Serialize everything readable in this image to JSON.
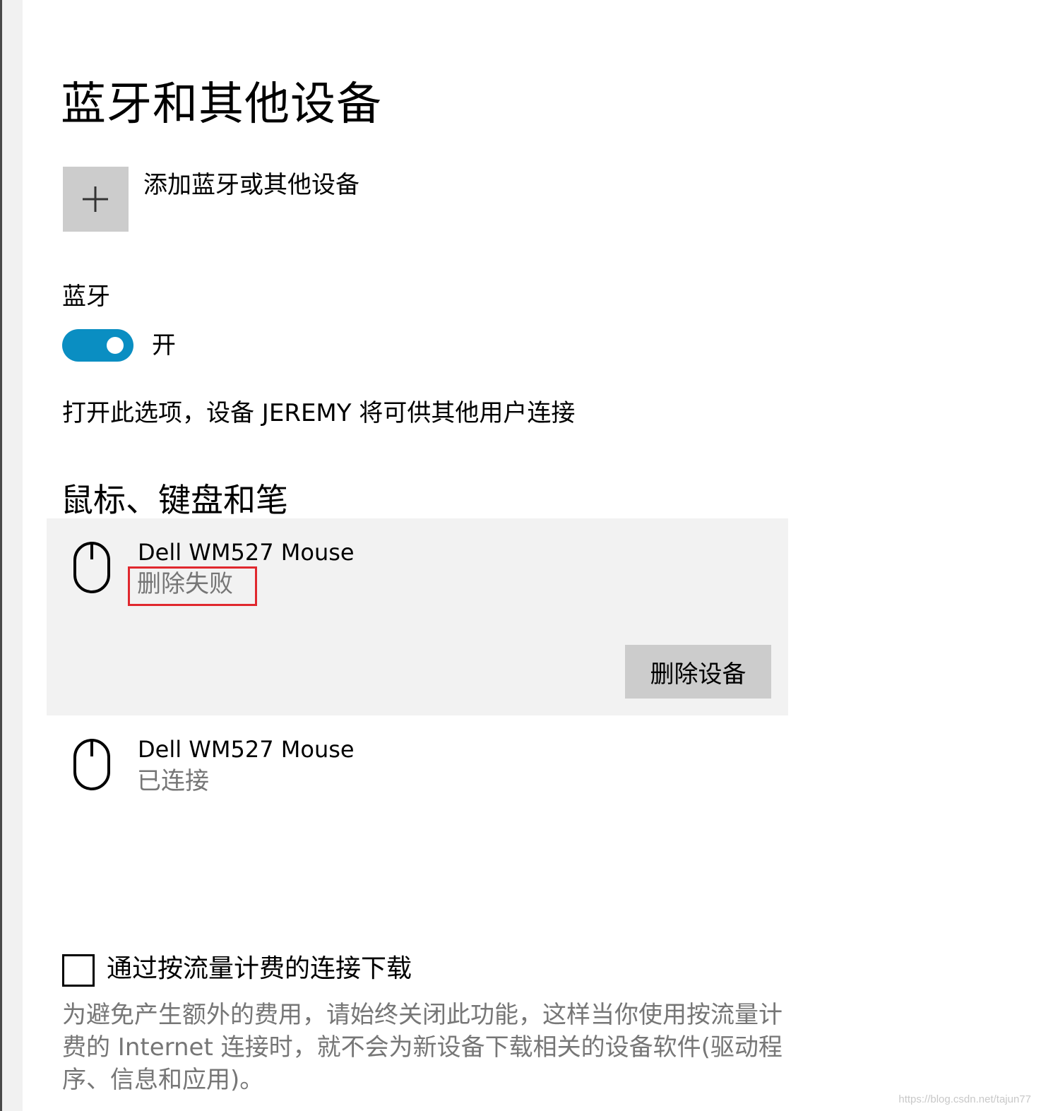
{
  "page": {
    "title": "蓝牙和其他设备"
  },
  "add_device": {
    "label": "添加蓝牙或其他设备",
    "icon": "plus-icon"
  },
  "bluetooth": {
    "label": "蓝牙",
    "toggle_state": "开",
    "toggle_on": true,
    "description": "打开此选项，设备 JEREMY 将可供其他用户连接",
    "accent_color": "#0a8ec2"
  },
  "mouse_section": {
    "title": "鼠标、键盘和笔",
    "devices": [
      {
        "name": "Dell WM527 Mouse",
        "status": "删除失败",
        "icon": "mouse-icon",
        "selected": true,
        "action_label": "删除设备"
      },
      {
        "name": "Dell WM527 Mouse",
        "status": "已连接",
        "icon": "mouse-icon",
        "selected": false
      }
    ]
  },
  "metered": {
    "checkbox_label": "通过按流量计费的连接下载",
    "checked": false,
    "description": "为避免产生额外的费用，请始终关闭此功能，这样当你使用按流量计费的 Internet 连接时，就不会为新设备下载相关的设备软件(驱动程序、信息和应用)。"
  },
  "watermark": "https://blog.csdn.net/tajun77",
  "annotation_color": "#e0282e"
}
